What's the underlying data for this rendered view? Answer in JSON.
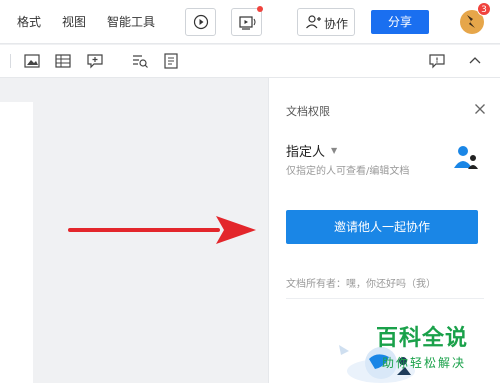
{
  "menu": {
    "format": "格式",
    "view": "视图",
    "smart_tools": "智能工具"
  },
  "header": {
    "collab_label": "协作",
    "share_label": "分享",
    "notification_count": "3"
  },
  "panel": {
    "title": "文档权限",
    "permission_label": "指定人",
    "permission_desc": "仅指定的人可查看/编辑文档",
    "invite_button": "邀请他人一起协作",
    "owner_line": "文档所有者：嘿，你还好吗（我）"
  },
  "watermark": {
    "title": "百科全说",
    "subtitle": "助你轻松解决"
  },
  "colors": {
    "accent": "#1a6ff0",
    "invite": "#1a86e6",
    "arrow": "#e3262b",
    "watermark": "#1aa14a"
  },
  "icons": [
    "play-icon",
    "present-icon",
    "add-user-icon",
    "image-icon",
    "table-icon",
    "comment-add-icon",
    "text-search-icon",
    "document-icon",
    "comment-icon",
    "chevron-up-icon",
    "close-icon",
    "users-icon"
  ]
}
